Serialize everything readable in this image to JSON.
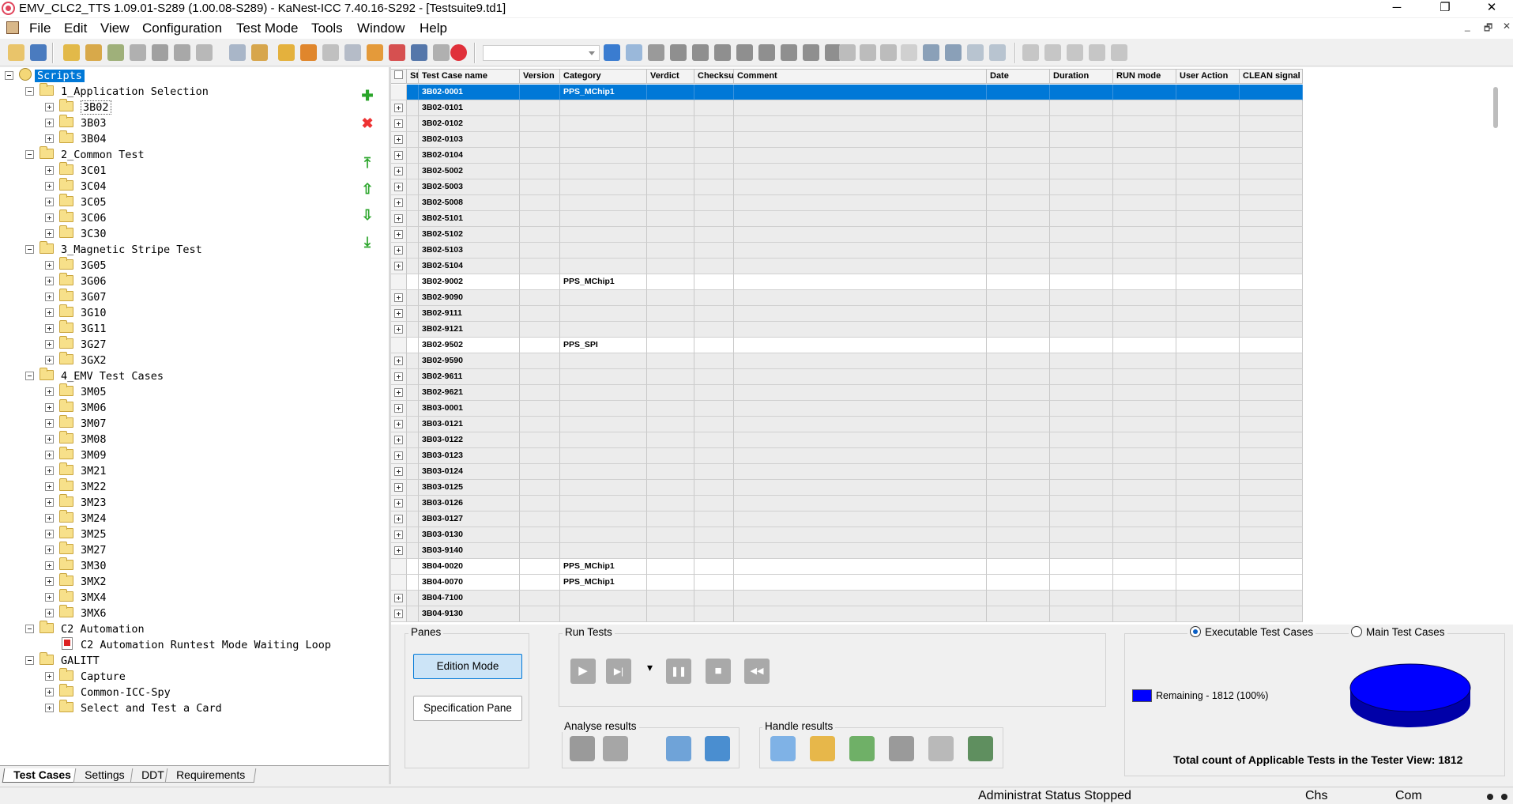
{
  "window": {
    "title": "EMV_CLC2_TTS 1.09.01-S289 (1.00.08-S289)  - KaNest-ICC 7.40.16-S292 - [Testsuite9.td1]",
    "minimize": "─",
    "restore": "❐",
    "close": "✕"
  },
  "menu": {
    "items": [
      "File",
      "Edit",
      "View",
      "Configuration",
      "Test Mode",
      "Tools",
      "Window",
      "Help"
    ],
    "mdi": [
      "_",
      "🗗",
      "✕"
    ]
  },
  "tree": {
    "root": "Scripts",
    "groups": [
      {
        "label": "1_Application Selection",
        "children": [
          "3B02",
          "3B03",
          "3B04"
        ]
      },
      {
        "label": "2_Common Test",
        "children": [
          "3C01",
          "3C04",
          "3C05",
          "3C06",
          "3C30"
        ]
      },
      {
        "label": "3_Magnetic Stripe Test",
        "children": [
          "3G05",
          "3G06",
          "3G07",
          "3G10",
          "3G11",
          "3G27",
          "3GX2"
        ]
      },
      {
        "label": "4_EMV Test Cases",
        "children": [
          "3M05",
          "3M06",
          "3M07",
          "3M08",
          "3M09",
          "3M21",
          "3M22",
          "3M23",
          "3M24",
          "3M25",
          "3M27",
          "3M30",
          "3MX2",
          "3MX4",
          "3MX6"
        ]
      },
      {
        "label": "C2 Automation",
        "children": [
          "C2 Automation Runtest Mode Waiting Loop"
        ]
      },
      {
        "label": "GALITT",
        "children": [
          "Capture",
          "Common-ICC-Spy",
          "Select and Test a Card"
        ]
      }
    ]
  },
  "side_buttons": {
    "add": "✚",
    "delete": "✖",
    "top": "⤒",
    "up": "⇧",
    "down": "⇩",
    "bottom": "⤓"
  },
  "tabs": [
    "Test Cases",
    "Settings",
    "DDT",
    "Requirements"
  ],
  "grid": {
    "columns": [
      "Sta",
      "Test Case name",
      "Version",
      "Category",
      "Verdict",
      "Checksu",
      "Comment",
      "Date",
      "Duration",
      "RUN mode",
      "User Action",
      "CLEAN signal"
    ],
    "rows": [
      {
        "name": "3B02-0001",
        "category": "PPS_MChip1",
        "state": "sel",
        "exp": false
      },
      {
        "name": "3B02-0101",
        "category": "",
        "state": "gray",
        "exp": true
      },
      {
        "name": "3B02-0102",
        "category": "",
        "state": "gray",
        "exp": true
      },
      {
        "name": "3B02-0103",
        "category": "",
        "state": "gray",
        "exp": true
      },
      {
        "name": "3B02-0104",
        "category": "",
        "state": "gray",
        "exp": true
      },
      {
        "name": "3B02-5002",
        "category": "",
        "state": "gray",
        "exp": true
      },
      {
        "name": "3B02-5003",
        "category": "",
        "state": "gray",
        "exp": true
      },
      {
        "name": "3B02-5008",
        "category": "",
        "state": "gray",
        "exp": true
      },
      {
        "name": "3B02-5101",
        "category": "",
        "state": "gray",
        "exp": true
      },
      {
        "name": "3B02-5102",
        "category": "",
        "state": "gray",
        "exp": true
      },
      {
        "name": "3B02-5103",
        "category": "",
        "state": "gray",
        "exp": true
      },
      {
        "name": "3B02-5104",
        "category": "",
        "state": "gray",
        "exp": true
      },
      {
        "name": "3B02-9002",
        "category": "PPS_MChip1",
        "state": "white",
        "exp": false
      },
      {
        "name": "3B02-9090",
        "category": "",
        "state": "gray",
        "exp": true
      },
      {
        "name": "3B02-9111",
        "category": "",
        "state": "gray",
        "exp": true
      },
      {
        "name": "3B02-9121",
        "category": "",
        "state": "gray",
        "exp": true
      },
      {
        "name": "3B02-9502",
        "category": "PPS_SPI",
        "state": "white",
        "exp": false
      },
      {
        "name": "3B02-9590",
        "category": "",
        "state": "gray",
        "exp": true
      },
      {
        "name": "3B02-9611",
        "category": "",
        "state": "gray",
        "exp": true
      },
      {
        "name": "3B02-9621",
        "category": "",
        "state": "gray",
        "exp": true
      },
      {
        "name": "3B03-0001",
        "category": "",
        "state": "gray",
        "exp": true
      },
      {
        "name": "3B03-0121",
        "category": "",
        "state": "gray",
        "exp": true
      },
      {
        "name": "3B03-0122",
        "category": "",
        "state": "gray",
        "exp": true
      },
      {
        "name": "3B03-0123",
        "category": "",
        "state": "gray",
        "exp": true
      },
      {
        "name": "3B03-0124",
        "category": "",
        "state": "gray",
        "exp": true
      },
      {
        "name": "3B03-0125",
        "category": "",
        "state": "gray",
        "exp": true
      },
      {
        "name": "3B03-0126",
        "category": "",
        "state": "gray",
        "exp": true
      },
      {
        "name": "3B03-0127",
        "category": "",
        "state": "gray",
        "exp": true
      },
      {
        "name": "3B03-0130",
        "category": "",
        "state": "gray",
        "exp": true
      },
      {
        "name": "3B03-9140",
        "category": "",
        "state": "gray",
        "exp": true
      },
      {
        "name": "3B04-0020",
        "category": "PPS_MChip1",
        "state": "white",
        "exp": false
      },
      {
        "name": "3B04-0070",
        "category": "PPS_MChip1",
        "state": "white",
        "exp": false
      },
      {
        "name": "3B04-7100",
        "category": "",
        "state": "gray",
        "exp": true
      },
      {
        "name": "3B04-9130",
        "category": "",
        "state": "gray",
        "exp": true
      }
    ]
  },
  "panes": {
    "title": "Panes",
    "edition_mode": "Edition Mode",
    "specification_pane": "Specification Pane"
  },
  "run_tests": {
    "title": "Run Tests",
    "play": "▶",
    "step": "▶|",
    "dropdown": "▾",
    "pause": "❚❚",
    "stop": "■",
    "rewind": "◀◀"
  },
  "analyse": {
    "title": "Analyse results"
  },
  "handle": {
    "title": "Handle results"
  },
  "summary": {
    "executable": "Executable Test Cases",
    "main": "Main Test Cases",
    "executable_selected": true,
    "remaining_label": "Remaining - 1812 (100%)",
    "remaining_color": "#0000ff",
    "total": "Total count of Applicable Tests in the Tester View: 1812",
    "pie": [
      {
        "label": "Remaining",
        "value": 1812,
        "fraction": 1.0
      }
    ]
  },
  "status": {
    "admin": "Administrat Status  Stopped",
    "lang": "Chs",
    "com": "Com"
  }
}
